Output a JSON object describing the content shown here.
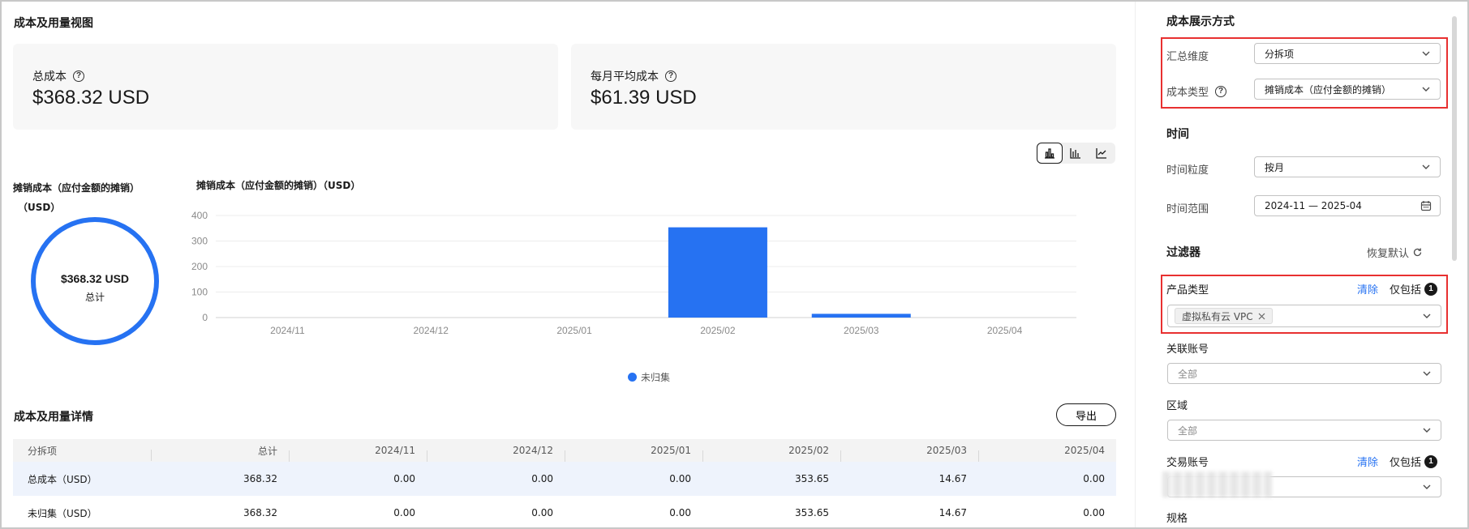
{
  "main": {
    "section_title": "成本及用量视图",
    "cards": [
      {
        "label": "总成本",
        "value": "$368.32 USD"
      },
      {
        "label": "每月平均成本",
        "value": "$61.39 USD"
      }
    ],
    "chart_switch": {
      "icons": [
        "bar-chart-icon",
        "stacked-bar-icon",
        "line-chart-icon"
      ],
      "active": 0
    },
    "donut": {
      "title_line1": "摊销成本（应付金额的摊销）",
      "title_line2": "（USD）",
      "value": "$368.32 USD",
      "sub": "总计",
      "color": "#2672f2"
    },
    "legend_label": "未归集",
    "details_title": "成本及用量详情",
    "export_label": "导出",
    "table": {
      "headers": [
        "分拆项",
        "总计",
        "2024/11",
        "2024/12",
        "2025/01",
        "2025/02",
        "2025/03",
        "2025/04"
      ],
      "rows": [
        [
          "总成本（USD）",
          "368.32",
          "0.00",
          "0.00",
          "0.00",
          "353.65",
          "14.67",
          "0.00"
        ],
        [
          "未归集（USD）",
          "368.32",
          "0.00",
          "0.00",
          "0.00",
          "353.65",
          "14.67",
          "0.00"
        ]
      ]
    }
  },
  "chart_data": {
    "type": "bar",
    "title": "摊销成本（应付金额的摊销）（USD）",
    "categories": [
      "2024/11",
      "2024/12",
      "2025/01",
      "2025/02",
      "2025/03",
      "2025/04"
    ],
    "series": [
      {
        "name": "未归集",
        "values": [
          0,
          0,
          0,
          353.65,
          14.67,
          0
        ]
      }
    ],
    "y_ticks": [
      0,
      100,
      200,
      300,
      400
    ],
    "ylim": [
      0,
      400
    ],
    "grid": true,
    "legend": "bottom",
    "color": "#2672f2"
  },
  "panel": {
    "display_title": "成本展示方式",
    "group_label": "汇总维度",
    "group_value": "分拆项",
    "cost_type_label": "成本类型",
    "cost_type_value": "摊销成本（应付金额的摊销）",
    "time_title": "时间",
    "granularity_label": "时间粒度",
    "granularity_value": "按月",
    "range_label": "时间范围",
    "range_value": "2024-11 — 2025-04",
    "filter_title": "过滤器",
    "reset_label": "恢复默认",
    "product_label": "产品类型",
    "clear_label": "清除",
    "include_label": "仅包括",
    "include_count": "1",
    "product_tag": "虚拟私有云 VPC",
    "linked_account_label": "关联账号",
    "all_label": "全部",
    "region_label": "区域",
    "trade_account_label": "交易账号",
    "spec_label": "规格"
  }
}
